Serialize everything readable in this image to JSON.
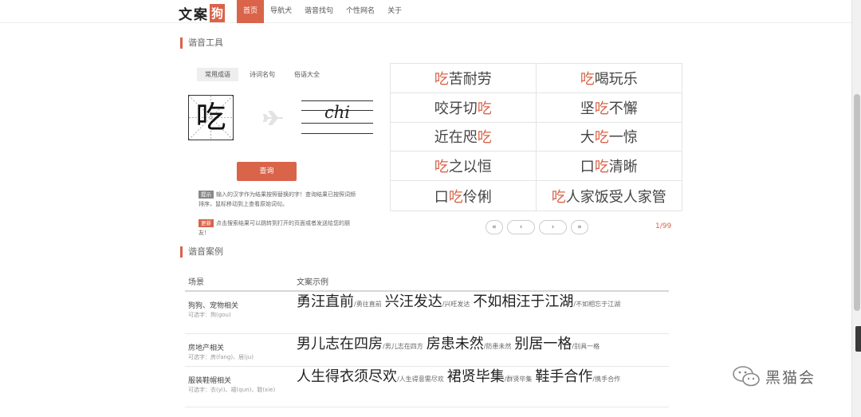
{
  "header": {
    "logo_text": "文案",
    "logo_mark": "狗",
    "nav": [
      {
        "label": "首页",
        "active": true
      },
      {
        "label": "导航犬",
        "active": false
      },
      {
        "label": "谐音找句",
        "active": false
      },
      {
        "label": "个性网名",
        "active": false
      },
      {
        "label": "关于",
        "active": false
      }
    ]
  },
  "tool": {
    "section_title": "谐音工具",
    "tabs": [
      {
        "label": "常用成语",
        "active": true
      },
      {
        "label": "诗词名句",
        "active": false
      },
      {
        "label": "俗语大全",
        "active": false
      }
    ],
    "input_char": "吃",
    "pinyin": "chi",
    "query_label": "查询",
    "tip": {
      "tag": "提示",
      "text": "输入的汉字作为结果按照替换的字！查询结果已按照词频排序，鼠标移动到上查看原始词句。"
    },
    "update": {
      "tag": "更新",
      "text": "点击搜索结果可以跳转到打开的页面或者发送给您的朋友！"
    }
  },
  "idioms": [
    [
      {
        "t": "吃",
        "h": true
      },
      {
        "t": "苦耐劳",
        "h": false
      }
    ],
    [
      {
        "t": "吃",
        "h": true
      },
      {
        "t": "喝玩乐",
        "h": false
      }
    ],
    [
      {
        "t": "咬牙切",
        "h": false
      },
      {
        "t": "吃",
        "h": true
      }
    ],
    [
      {
        "t": "坚",
        "h": false
      },
      {
        "t": "吃",
        "h": true
      },
      {
        "t": "不懈",
        "h": false
      }
    ],
    [
      {
        "t": "近在咫",
        "h": false
      },
      {
        "t": "吃",
        "h": true
      }
    ],
    [
      {
        "t": "大",
        "h": false
      },
      {
        "t": "吃",
        "h": true
      },
      {
        "t": "一惊",
        "h": false
      }
    ],
    [
      {
        "t": "吃",
        "h": true
      },
      {
        "t": "之以恒",
        "h": false
      }
    ],
    [
      {
        "t": "口",
        "h": false
      },
      {
        "t": "吃",
        "h": true
      },
      {
        "t": "清晰",
        "h": false
      }
    ],
    [
      {
        "t": "口",
        "h": false
      },
      {
        "t": "吃",
        "h": true
      },
      {
        "t": "伶俐",
        "h": false
      }
    ],
    [
      {
        "t": "吃",
        "h": true
      },
      {
        "t": "人家饭受人家管",
        "h": false
      }
    ]
  ],
  "pager": {
    "first": "«",
    "prev": "‹",
    "next": "›",
    "last": "»",
    "count": "1/99"
  },
  "cases": {
    "section_title": "谐音案例",
    "col_scene": "场景",
    "col_example": "文案示例",
    "rows": [
      {
        "scene": "狗狗、宠物相关",
        "sub": "可选字：狗(gou)",
        "examples": [
          {
            "parts": [
              {
                "t": "勇",
                "h": false
              },
              {
                "t": "汪",
                "h": true
              },
              {
                "t": "直前",
                "h": false
              }
            ],
            "orig": "/勇往直前"
          },
          {
            "parts": [
              {
                "t": "兴",
                "h": false
              },
              {
                "t": "汪",
                "h": true
              },
              {
                "t": "发达",
                "h": false
              }
            ],
            "orig": "/兴旺发达"
          },
          {
            "parts": [
              {
                "t": "不如相",
                "h": false
              },
              {
                "t": "汪",
                "h": true
              },
              {
                "t": "于江湖",
                "h": false
              }
            ],
            "orig": "/不如相忘于江湖"
          }
        ]
      },
      {
        "scene": "房地产相关",
        "sub": "可选字：房(fang)、居(ju)",
        "examples": [
          {
            "parts": [
              {
                "t": "男儿志在四",
                "h": false
              },
              {
                "t": "房",
                "h": true
              }
            ],
            "orig": "/男儿志在四方"
          },
          {
            "parts": [
              {
                "t": "房",
                "h": true
              },
              {
                "t": "患未然",
                "h": false
              }
            ],
            "orig": "/防患未然"
          },
          {
            "parts": [
              {
                "t": "别",
                "h": false
              },
              {
                "t": "居",
                "h": true
              },
              {
                "t": "一格",
                "h": false
              }
            ],
            "orig": "/别具一格"
          }
        ]
      },
      {
        "scene": "服装鞋帽相关",
        "sub": "可选字：衣(yi)、裙(qun)、鞋(xie)",
        "examples": [
          {
            "parts": [
              {
                "t": "人生得",
                "h": false
              },
              {
                "t": "衣",
                "h": true
              },
              {
                "t": "须尽欢",
                "h": false
              }
            ],
            "orig": "/人生得意需尽欢"
          },
          {
            "parts": [
              {
                "t": "裙",
                "h": true
              },
              {
                "t": "贤毕集",
                "h": false
              }
            ],
            "orig": "/群贤毕集"
          },
          {
            "parts": [
              {
                "t": "鞋",
                "h": true
              },
              {
                "t": "手合作",
                "h": false
              }
            ],
            "orig": "/携手合作"
          }
        ]
      }
    ]
  },
  "watermark": "黑猫会",
  "colors": {
    "accent": "#d9644a"
  }
}
